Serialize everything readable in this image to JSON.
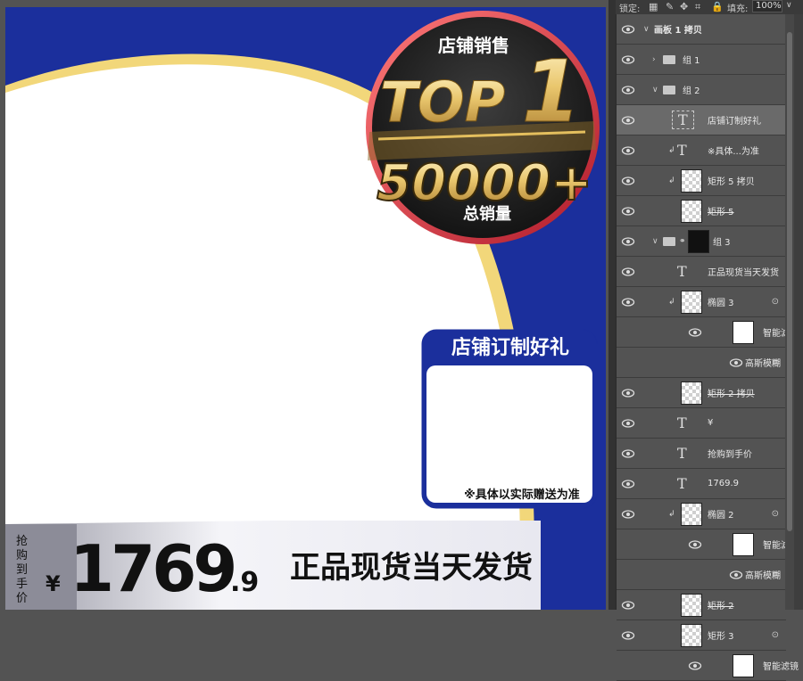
{
  "toolbar": {
    "lock_label": "锁定:",
    "fill_label": "填充:",
    "fill_value": "100%"
  },
  "poster": {
    "badge": {
      "top_text": "店铺销售",
      "rank_text": "TOP",
      "rank_number": "1",
      "sales_number": "50000+",
      "bottom_text": "总销量"
    },
    "gift_box": {
      "title": "店铺订制好礼",
      "note": "※具体以实际赠送为准"
    },
    "price_bar": {
      "price_label": "抢购到手价",
      "currency": "¥",
      "price_int": "1769",
      "price_dec": ".9",
      "slogan": "正品现货当天发货"
    },
    "colors": {
      "blue": "#1b2f9c",
      "gold": "#f2d77a",
      "dark": "#2a2a2a"
    }
  },
  "layers": [
    {
      "name": "画板 1 拷贝",
      "type": "artboard",
      "indent": 0,
      "expanded": true
    },
    {
      "name": "组 1",
      "type": "group",
      "indent": 1,
      "expanded": false
    },
    {
      "name": "组 2",
      "type": "group",
      "indent": 1,
      "expanded": true
    },
    {
      "name": "店铺订制好礼",
      "type": "text",
      "indent": 2,
      "selected": true
    },
    {
      "name": "※具体...为准",
      "type": "text",
      "indent": 2,
      "clipped": true
    },
    {
      "name": "矩形 5 拷贝",
      "type": "smart",
      "indent": 2,
      "clipped": true
    },
    {
      "name": "矩形 5",
      "type": "smart",
      "indent": 2,
      "strike": true
    },
    {
      "name": "组 3",
      "type": "group",
      "indent": 1,
      "expanded": true,
      "masked": true
    },
    {
      "name": "正品现货当天发货",
      "type": "text",
      "indent": 2
    },
    {
      "name": "椭圆 3",
      "type": "smart",
      "indent": 2,
      "clipped": true,
      "fx": true
    },
    {
      "name": "智能滤镜",
      "type": "filter",
      "indent": 3
    },
    {
      "name": "高斯模糊",
      "type": "filteritem",
      "indent": 3
    },
    {
      "name": "矩形 2 拷贝",
      "type": "smart",
      "indent": 2,
      "strike": true
    },
    {
      "name": "¥",
      "type": "text",
      "indent": 2
    },
    {
      "name": "抢购到手价",
      "type": "text",
      "indent": 2
    },
    {
      "name": "1769.9",
      "type": "text",
      "indent": 2
    },
    {
      "name": "椭圆 2",
      "type": "smart",
      "indent": 2,
      "clipped": true,
      "fx": true
    },
    {
      "name": "智能滤镜",
      "type": "filter",
      "indent": 3
    },
    {
      "name": "高斯模糊",
      "type": "filteritem",
      "indent": 3
    },
    {
      "name": "矩形 2",
      "type": "smart",
      "indent": 2,
      "strike": true
    },
    {
      "name": "矩形 3",
      "type": "smart",
      "indent": 2,
      "fx": true
    },
    {
      "name": "智能滤镜",
      "type": "filter",
      "indent": 3
    }
  ]
}
